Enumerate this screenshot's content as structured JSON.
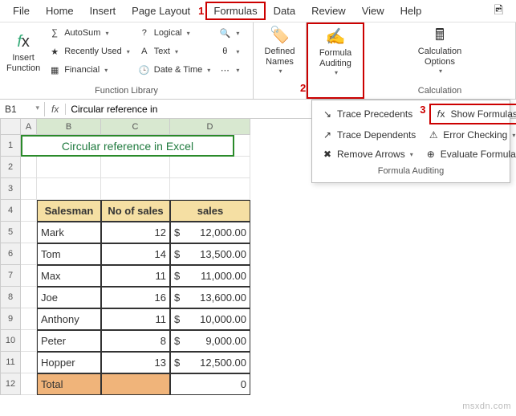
{
  "menu": {
    "file": "File",
    "home": "Home",
    "insert": "Insert",
    "pagelayout": "Page Layout",
    "formulas": "Formulas",
    "data": "Data",
    "review": "Review",
    "view": "View",
    "help": "Help"
  },
  "annot": {
    "one": "1",
    "two": "2",
    "three": "3"
  },
  "ribbon": {
    "insertfn": "Insert\nFunction",
    "autosum": "AutoSum",
    "recent": "Recently Used",
    "financial": "Financial",
    "logical": "Logical",
    "text": "Text",
    "datetime": "Date & Time",
    "defnames": "Defined\nNames",
    "fauditing": "Formula\nAuditing",
    "calcopts": "Calculation\nOptions",
    "grp_funclib": "Function Library",
    "grp_calc": "Calculation"
  },
  "dropdown": {
    "trace_prec": "Trace Precedents",
    "trace_dep": "Trace Dependents",
    "remove_arrows": "Remove Arrows",
    "show_formulas": "Show Formulas",
    "error_check": "Error Checking",
    "eval_formula": "Evaluate Formula",
    "title": "Formula Auditing"
  },
  "fbar": {
    "cellref": "B1",
    "fx": "fx",
    "value": "Circular reference in"
  },
  "cols": {
    "A": "A",
    "B": "B",
    "C": "C",
    "D": "D"
  },
  "title_cell": "Circular reference in Excel",
  "headers": {
    "salesman": "Salesman",
    "nsales": "No of sales",
    "sales": "sales"
  },
  "rows": [
    {
      "name": "Mark",
      "n": "12",
      "cur": "$",
      "val": "12,000.00"
    },
    {
      "name": "Tom",
      "n": "14",
      "cur": "$",
      "val": "13,500.00"
    },
    {
      "name": "Max",
      "n": "11",
      "cur": "$",
      "val": "11,000.00"
    },
    {
      "name": "Joe",
      "n": "16",
      "cur": "$",
      "val": "13,600.00"
    },
    {
      "name": "Anthony",
      "n": "11",
      "cur": "$",
      "val": "10,000.00"
    },
    {
      "name": "Peter",
      "n": "8",
      "cur": "$",
      "val": "9,000.00"
    },
    {
      "name": "Hopper",
      "n": "13",
      "cur": "$",
      "val": "12,500.00"
    }
  ],
  "total": {
    "label": "Total",
    "val": "0"
  },
  "rownums": [
    "1",
    "2",
    "3",
    "4",
    "5",
    "6",
    "7",
    "8",
    "9",
    "10",
    "11",
    "12"
  ],
  "watermark": "msxdn.com"
}
